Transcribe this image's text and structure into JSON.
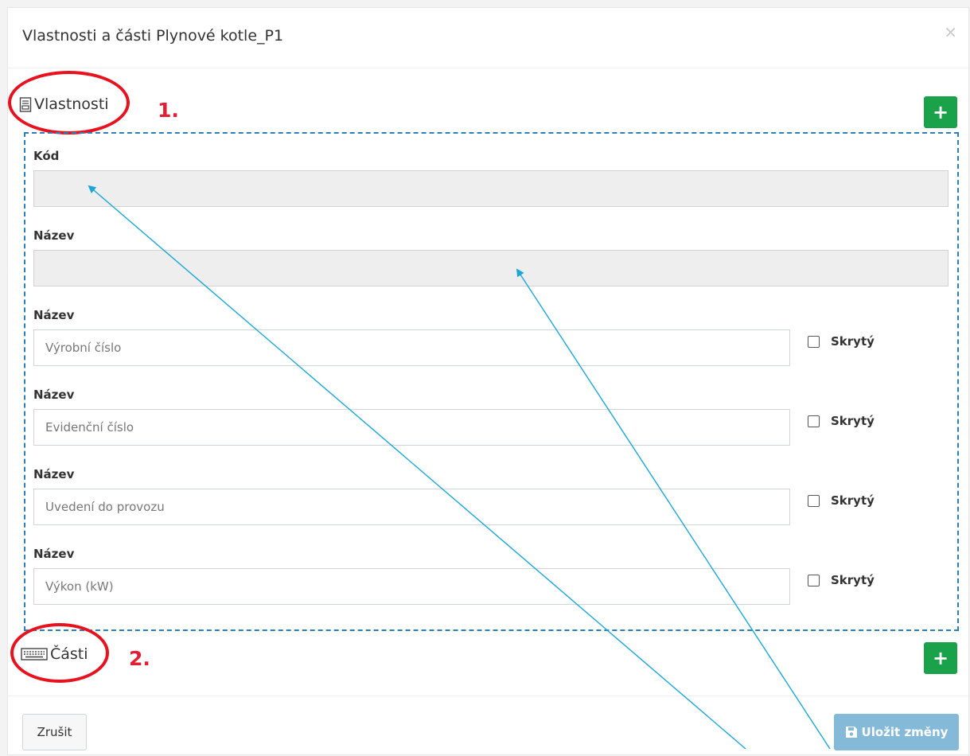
{
  "modal": {
    "title": "Vlastnosti a části Plynové kotle_P1",
    "close_symbol": "×"
  },
  "sections": {
    "properties": {
      "title": "Vlastnosti",
      "icon": "document-icon",
      "annotation": "1.",
      "add_label": "+"
    },
    "parts": {
      "title": "Části",
      "icon": "keyboard-icon",
      "annotation": "2.",
      "add_label": "+"
    }
  },
  "fields": {
    "code": {
      "label": "Kód",
      "value": ""
    },
    "name": {
      "label": "Název",
      "value": ""
    },
    "props": [
      {
        "label": "Název",
        "placeholder": "Výrobní číslo",
        "hidden_label": "Skrytý"
      },
      {
        "label": "Název",
        "placeholder": "Evidenční číslo",
        "hidden_label": "Skrytý"
      },
      {
        "label": "Název",
        "placeholder": "Uvedení do provozu",
        "hidden_label": "Skrytý"
      },
      {
        "label": "Název",
        "placeholder": "Výkon (kW)",
        "hidden_label": "Skrytý"
      }
    ]
  },
  "footer": {
    "cancel_label": "Zrušit",
    "save_label": "Uložit změny",
    "save_icon": "floppy-disk-icon"
  },
  "colors": {
    "annotation_red": "#e8111e",
    "add_green": "#19a24a",
    "dashed_blue": "#2d7fb8",
    "arrow_cyan": "#1ba7d8",
    "save_blue": "#85b9d8"
  }
}
